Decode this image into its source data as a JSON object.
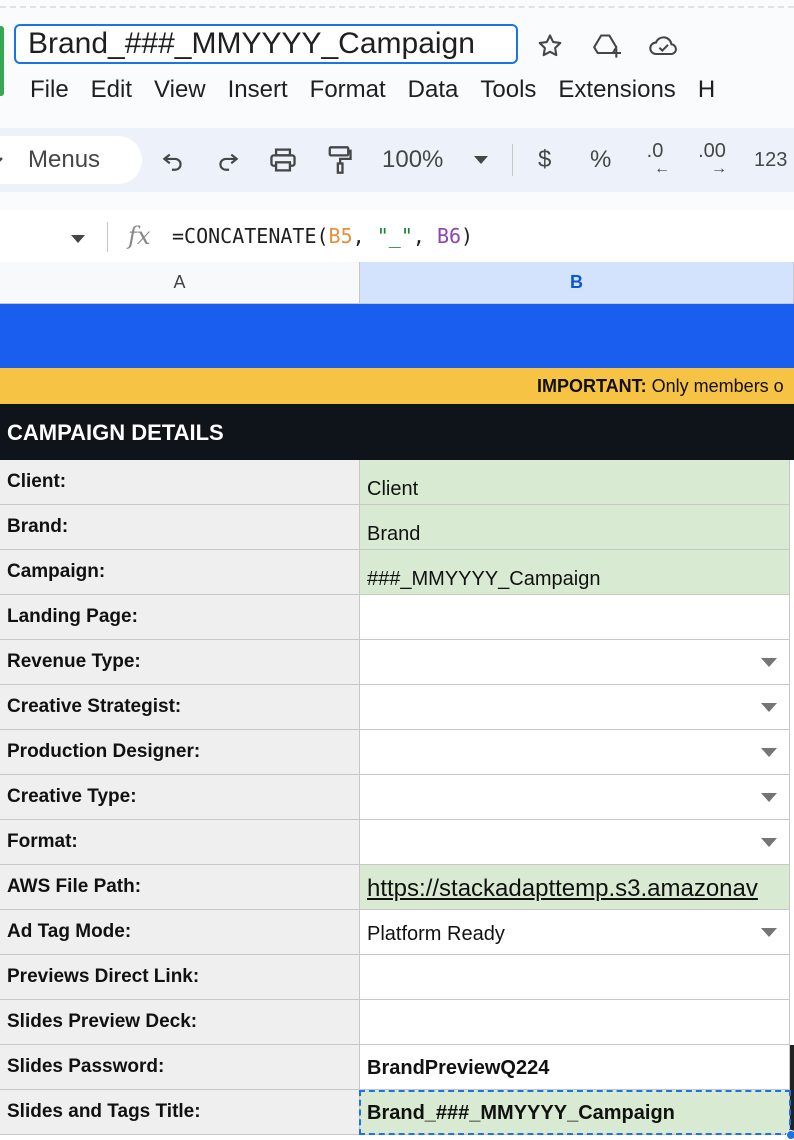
{
  "doc": {
    "title": "Brand_###_MMYYYY_Campaign",
    "menus": [
      "File",
      "Edit",
      "View",
      "Insert",
      "Format",
      "Data",
      "Tools",
      "Extensions",
      "H"
    ]
  },
  "toolbar": {
    "menus_label": "Menus",
    "zoom": "100%",
    "currency": "$",
    "percent": "%",
    "decrease_decimal": ".0",
    "increase_decimal": ".00",
    "number_format": "123"
  },
  "formula_bar": {
    "fx": "fx",
    "formula_prefix": "=CONCATENATE(",
    "ref1": "B5",
    "sep1": ", ",
    "str": "\"_\"",
    "sep2": ", ",
    "ref2": "B6",
    "formula_suffix": ")",
    "colors": {
      "ref1": "#e69138",
      "str": "#188038",
      "ref2": "#8e44ad"
    }
  },
  "grid": {
    "columns": [
      "A",
      "B"
    ],
    "important_label": "IMPORTANT:",
    "important_text": " Only members o",
    "section_title": "CAMPAIGN DETAILS",
    "rows": [
      {
        "label": "Client:",
        "value": "Client"
      },
      {
        "label": "Brand:",
        "value": "Brand"
      },
      {
        "label": "Campaign:",
        "value": "###_MMYYYY_Campaign"
      },
      {
        "label": "Landing Page:",
        "value": ""
      },
      {
        "label": "Revenue Type:",
        "value": ""
      },
      {
        "label": "Creative Strategist:",
        "value": ""
      },
      {
        "label": "Production Designer:",
        "value": ""
      },
      {
        "label": "Creative Type:",
        "value": ""
      },
      {
        "label": "Format:",
        "value": ""
      },
      {
        "label": "AWS File Path:",
        "value": "https://stackadapttemp.s3.amazonav"
      },
      {
        "label": "Ad Tag Mode:",
        "value": "Platform Ready"
      },
      {
        "label": "Previews Direct Link:",
        "value": ""
      },
      {
        "label": "Slides Preview Deck:",
        "value": ""
      },
      {
        "label": "Slides Password:",
        "value": "BrandPreviewQ224"
      },
      {
        "label": "Slides and Tags Title:",
        "value": "Brand_###_MMYYYY_Campaign"
      }
    ]
  },
  "colors": {
    "banner": "#1a5ef0",
    "important": "#f6c345",
    "section": "#0f141a",
    "input_green": "#d9ead3",
    "accent": "#1a73e8"
  }
}
